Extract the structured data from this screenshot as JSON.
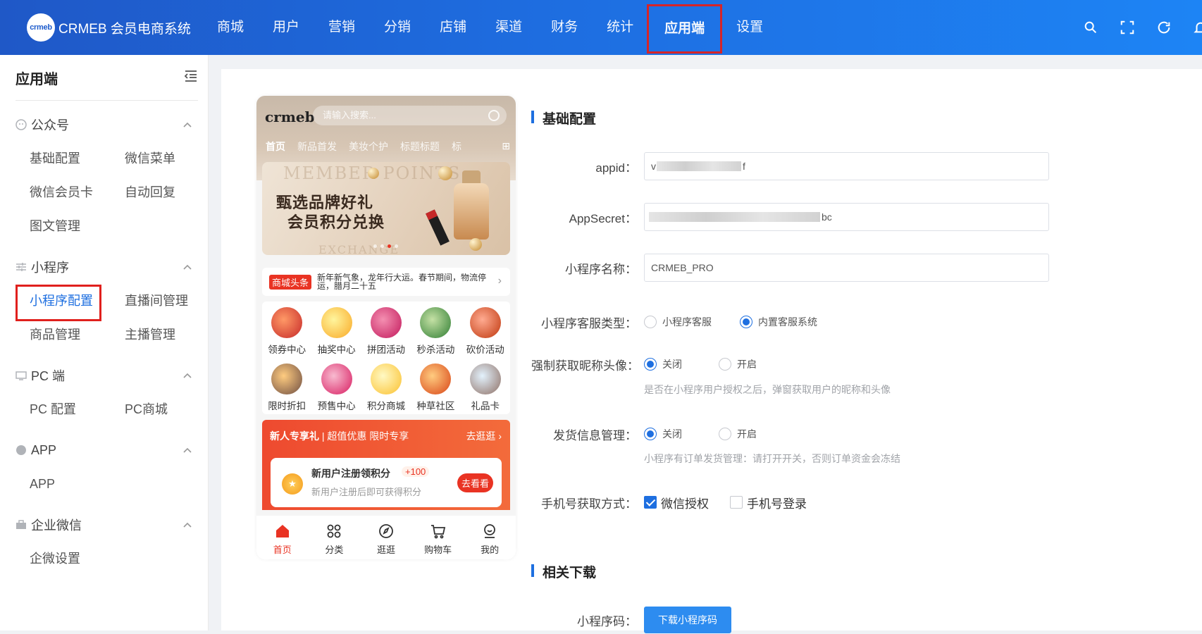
{
  "colors": {
    "primary": "#1e6fe0",
    "highlight_box": "#e0201d",
    "topbar_start": "#1f58c7",
    "topbar_end": "#1d84f5"
  },
  "topbar": {
    "logo_badge": "crmeb",
    "app_name": "CRMEB 会员电商系统",
    "nav": [
      "商城",
      "用户",
      "营销",
      "分销",
      "店铺",
      "渠道",
      "财务",
      "统计",
      "应用端",
      "设置"
    ],
    "active_nav": "应用端",
    "icons": [
      "search-icon",
      "fullscreen-icon",
      "refresh-icon",
      "bell-icon"
    ]
  },
  "sidebar": {
    "title": "应用端",
    "groups": [
      {
        "name": "公众号",
        "icon": "wechat-icon",
        "items": [
          "基础配置",
          "微信菜单",
          "微信会员卡",
          "自动回复",
          "图文管理"
        ]
      },
      {
        "name": "小程序",
        "icon": "sliders-icon",
        "items": [
          "小程序配置",
          "直播间管理",
          "商品管理",
          "主播管理"
        ]
      },
      {
        "name": "PC 端",
        "icon": "monitor-icon",
        "items": [
          "PC 配置",
          "PC商城"
        ]
      },
      {
        "name": "APP",
        "icon": "app-icon",
        "items": [
          "APP"
        ]
      },
      {
        "name": "企业微信",
        "icon": "briefcase-icon",
        "items": [
          "企微设置"
        ]
      }
    ],
    "active_item": "小程序配置"
  },
  "phone": {
    "logo": "crmeb",
    "search_placeholder": "请输入搜索...",
    "tabs": [
      "首页",
      "新品首发",
      "美妆个护",
      "标题标题",
      "标"
    ],
    "banner": {
      "bg_text": "MEMBER POINTS",
      "line1": "甄选品牌好礼",
      "line2": "会员积分兑换",
      "bottom_text": "EXCHANGE"
    },
    "news": {
      "tag": "商城头条",
      "text": "新年新气象，龙年行大运。春节期间，物流停运，腊月二十五"
    },
    "grid": [
      "领券中心",
      "抽奖中心",
      "拼团活动",
      "秒杀活动",
      "砍价活动",
      "限时折扣",
      "预售中心",
      "积分商城",
      "种草社区",
      "礼品卡"
    ],
    "promo": {
      "title": "新人专享礼",
      "subtitle": "超值优惠 限时专享",
      "more": "去逛逛 ›",
      "card_title": "新用户注册领积分",
      "card_points": "+100",
      "card_desc": "新用户注册后即可获得积分",
      "card_btn": "去看看"
    },
    "tabbar": [
      "首页",
      "分类",
      "逛逛",
      "购物车",
      "我的"
    ]
  },
  "form": {
    "section_basic": "基础配置",
    "appid_label": "appid：",
    "appid_start": "v",
    "appid_end": "f",
    "secret_label": "AppSecret：",
    "secret_end": "bc",
    "name_label": "小程序名称：",
    "name_value": "CRMEB_PRO",
    "service_label": "小程序客服类型：",
    "service_options": [
      "小程序客服",
      "内置客服系统"
    ],
    "service_selected": "内置客服系统",
    "avatar_label": "强制获取昵称头像：",
    "avatar_options": [
      "关闭",
      "开启"
    ],
    "avatar_selected": "关闭",
    "avatar_hint": "是否在小程序用户授权之后，弹窗获取用户的昵称和头像",
    "ship_label": "发货信息管理：",
    "ship_options": [
      "关闭",
      "开启"
    ],
    "ship_selected": "关闭",
    "ship_hint": "小程序有订单发货管理：请打开开关，否则订单资金会冻结",
    "phone_label": "手机号获取方式：",
    "phone_options": [
      "微信授权",
      "手机号登录"
    ],
    "phone_checked": [
      "微信授权"
    ],
    "section_download": "相关下载",
    "code_label": "小程序码：",
    "code_button": "下载小程序码"
  }
}
